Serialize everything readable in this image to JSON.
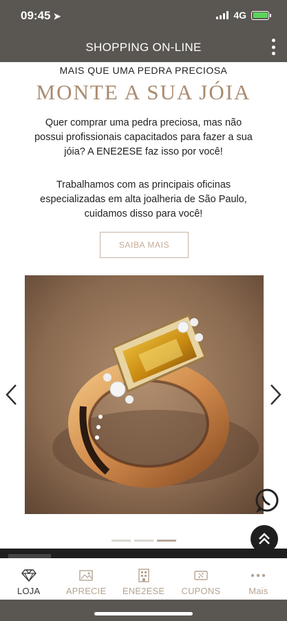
{
  "status_bar": {
    "time": "09:45",
    "network": "4G"
  },
  "app_bar": {
    "title": "SHOPPING ON-LINE"
  },
  "hero": {
    "kicker": "MAIS QUE UMA PEDRA PRECIOSA",
    "headline": "MONTE A SUA JÓIA",
    "paragraph_1": "Quer comprar uma pedra preciosa, mas não possui profissionais capacitados para fazer a sua jóia? A ENE2ESE faz isso por você!",
    "paragraph_2": "Trabalhamos com as principais oficinas especializadas em alta joalheria de São Paulo, cuidamos disso para você!",
    "cta_label": "SAIBA MAIS"
  },
  "carousel": {
    "slide_count": 3,
    "active_index": 2,
    "image": "gold-ring-citrine"
  },
  "bottom_nav": {
    "items": [
      {
        "label": "LOJA",
        "icon": "diamond-icon",
        "active": true
      },
      {
        "label": "APRECIE",
        "icon": "image-icon",
        "active": false
      },
      {
        "label": "ENE2ESE",
        "icon": "building-icon",
        "active": false
      },
      {
        "label": "CUPONS",
        "icon": "coupon-icon",
        "active": false
      },
      {
        "label": "Mais",
        "icon": "more-icon",
        "active": false
      }
    ]
  },
  "colors": {
    "bar": "#5a5752",
    "accent": "#a98b6e",
    "muted_label": "#b5a392"
  }
}
